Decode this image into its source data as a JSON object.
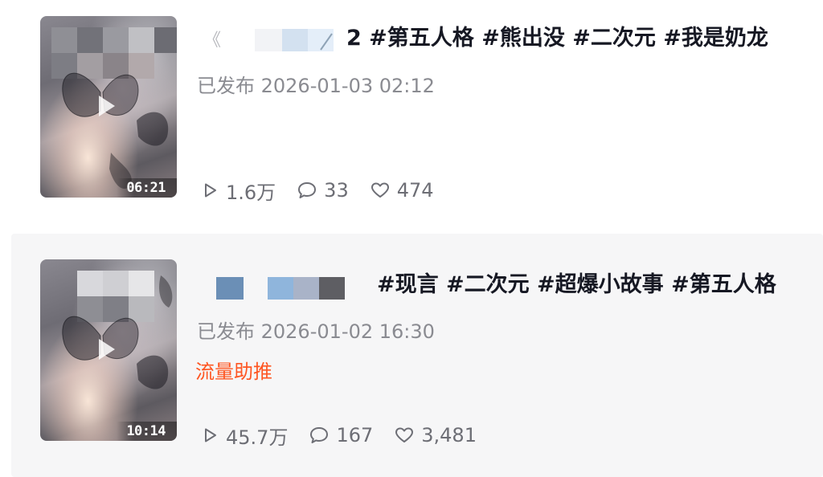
{
  "videos": [
    {
      "duration": "06:21",
      "title_hashtags": "2 #第五人格 #熊出没 #二次元 #我是奶龙",
      "published": "已发布 2026-01-03 02:12",
      "boost_label": "",
      "stats": {
        "plays": "1.6万",
        "comments": "33",
        "likes": "474"
      }
    },
    {
      "duration": "10:14",
      "title_hashtags": "#现言 #二次元 #超爆小故事 #第五人格",
      "published": "已发布 2026-01-02 16:30",
      "boost_label": "流量助推",
      "stats": {
        "plays": "45.7万",
        "comments": "167",
        "likes": "3,481"
      }
    }
  ],
  "icons": {
    "play": "play-count-icon",
    "comment": "comment-icon",
    "like": "heart-icon"
  },
  "colors": {
    "boost": "#fe5622",
    "meta_text": "#8a8b91",
    "title_text": "#161823",
    "card_highlight_bg": "#f6f6f7"
  }
}
